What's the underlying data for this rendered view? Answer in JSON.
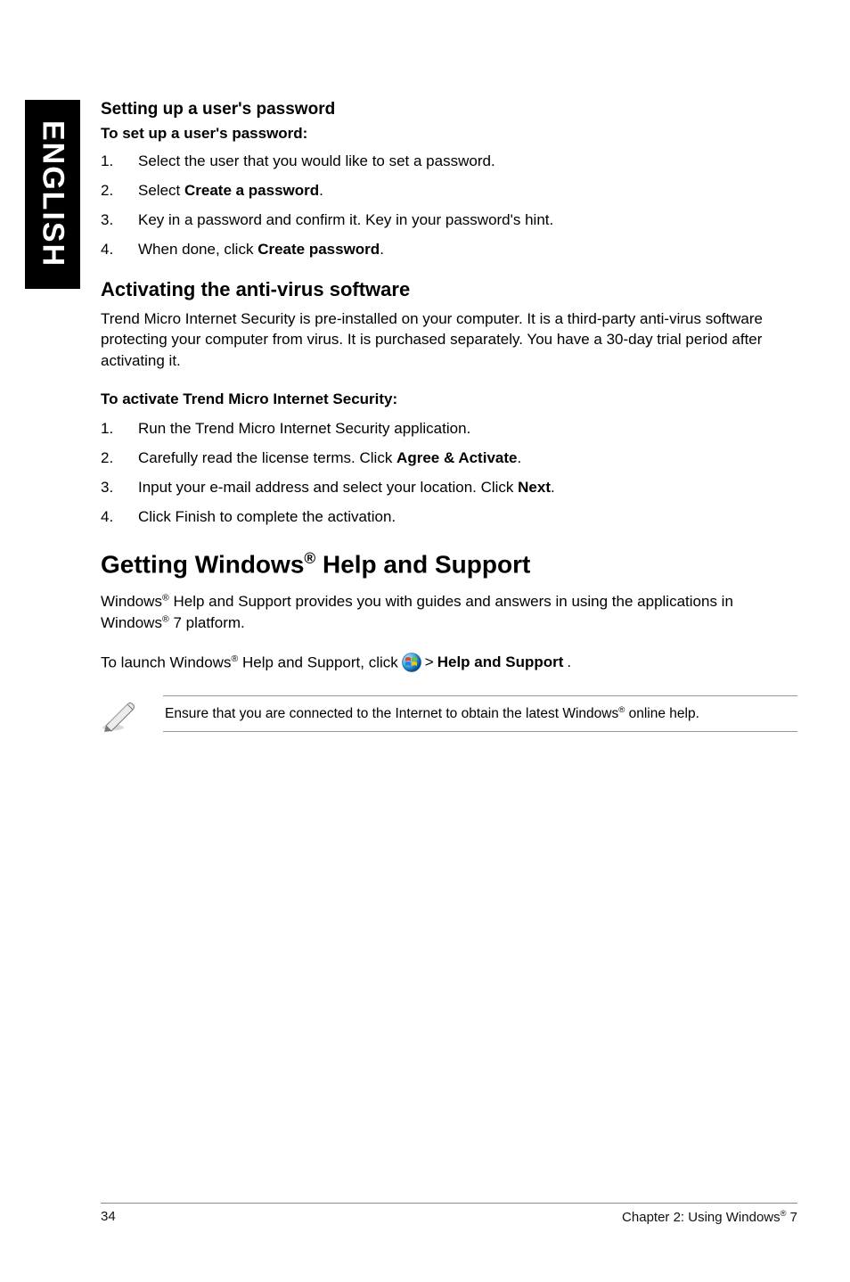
{
  "side_tab": "ENGLISH",
  "s1": {
    "heading": "Setting up a user's password",
    "subheading": "To set up a user's password:",
    "items": [
      {
        "n": "1.",
        "pre": "Select the user that you would like to set a password."
      },
      {
        "n": "2.",
        "pre": "Select ",
        "bold": "Create a password",
        "post": "."
      },
      {
        "n": "3.",
        "pre": "Key in a password and confirm it. Key in your password's hint."
      },
      {
        "n": "4.",
        "pre": "When done, click ",
        "bold": "Create password",
        "post": "."
      }
    ]
  },
  "s2": {
    "heading": "Activating the anti-virus software",
    "para": "Trend Micro Internet Security is pre-installed on your computer. It is a third-party anti-virus software protecting your computer from virus. It is purchased separately. You have a 30-day trial period after activating it.",
    "subheading": "To activate Trend Micro Internet Security:",
    "items": [
      {
        "n": "1.",
        "pre": "Run the Trend Micro Internet Security application."
      },
      {
        "n": "2.",
        "pre": "Carefully read the license terms. Click ",
        "bold": "Agree & Activate",
        "post": "."
      },
      {
        "n": "3.",
        "pre": "Input your e-mail address and select your location. Click ",
        "bold": "Next",
        "post": "."
      },
      {
        "n": "4.",
        "pre": "Click Finish to complete the activation."
      }
    ]
  },
  "s3": {
    "h1_a": "Getting Windows",
    "h1_sup": "®",
    "h1_b": " Help and Support",
    "p1_a": "Windows",
    "p1_sup1": "®",
    "p1_b": " Help and Support provides you with guides and answers in using the applications in Windows",
    "p1_sup2": "®",
    "p1_c": " 7 platform.",
    "l_a": "To launch Windows",
    "l_sup": "®",
    "l_b": " Help and Support, click ",
    "l_gt": " > ",
    "l_bold": "Help and Support",
    "l_end": ".",
    "note_a": "Ensure that you are connected to the Internet to obtain the latest Windows",
    "note_sup": "®",
    "note_b": " online help."
  },
  "footer": {
    "left": "34",
    "right_a": "Chapter 2: Using Windows",
    "right_sup": "®",
    "right_b": " 7"
  }
}
